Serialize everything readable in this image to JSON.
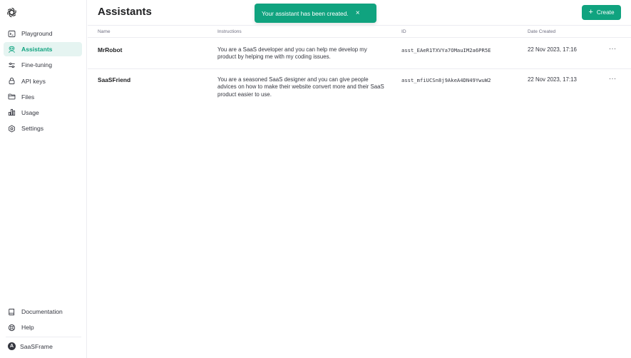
{
  "sidebar": {
    "items": [
      {
        "label": "Playground",
        "icon": "terminal-icon"
      },
      {
        "label": "Assistants",
        "icon": "robot-icon",
        "active": true
      },
      {
        "label": "Fine-tuning",
        "icon": "sliders-icon"
      },
      {
        "label": "API keys",
        "icon": "lock-icon"
      },
      {
        "label": "Files",
        "icon": "folder-icon"
      },
      {
        "label": "Usage",
        "icon": "bar-chart-icon"
      },
      {
        "label": "Settings",
        "icon": "gear-icon"
      }
    ],
    "bottom_items": [
      {
        "label": "Documentation",
        "icon": "book-icon"
      },
      {
        "label": "Help",
        "icon": "lifebuoy-icon"
      }
    ],
    "org": {
      "initial": "A",
      "name": "SaaSFrame"
    }
  },
  "header": {
    "title": "Assistants",
    "create_label": "Create"
  },
  "toast": {
    "message": "Your assistant has been created.",
    "close": "×"
  },
  "table": {
    "columns": [
      "Name",
      "Instructions",
      "ID",
      "Date Created"
    ],
    "rows": [
      {
        "name": "MrRobot",
        "instructions": "You are a SaaS developer and you can help me develop my product by helping me with my coding issues.",
        "id": "asst_EAeR1TXVYa7OMauIM2a6PR5E",
        "date": "22 Nov 2023, 17:16",
        "more": "···"
      },
      {
        "name": "SaaSFriend",
        "instructions": "You are a seasoned SaaS designer and you can give people advices on how to make their website convert more and their SaaS product easier to use.",
        "id": "asst_mfiUCSn8j9AkeA4DN49YwuW2",
        "date": "22 Nov 2023, 17:13",
        "more": "···"
      }
    ]
  },
  "colors": {
    "accent": "#10a37f",
    "active_bg": "#e5f4f1",
    "text": "#202123",
    "muted": "#6e6e80",
    "border": "#ececf1"
  }
}
